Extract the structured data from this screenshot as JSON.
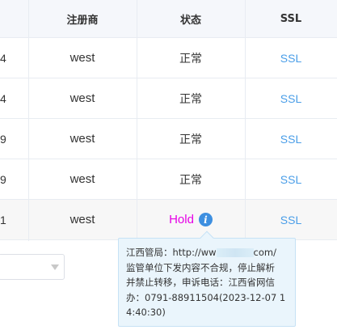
{
  "table": {
    "headers": [
      "",
      "注册商",
      "状态",
      "SSL"
    ],
    "rows": [
      {
        "num": "4",
        "registrar": "west",
        "status": "正常",
        "ssl": "SSL"
      },
      {
        "num": "4",
        "registrar": "west",
        "status": "正常",
        "ssl": "SSL"
      },
      {
        "num": "9",
        "registrar": "west",
        "status": "正常",
        "ssl": "SSL"
      },
      {
        "num": "9",
        "registrar": "west",
        "status": "正常",
        "ssl": "SSL"
      },
      {
        "num": "1",
        "registrar": "west",
        "status": "Hold",
        "ssl": "SSL"
      }
    ]
  },
  "tooltip": {
    "line1_prefix": "江西管局：http://ww",
    "line1_suffix": "com/",
    "line2": "监管单位下发内容不合规，停止解析",
    "line3": "并禁止转移，申诉电话：江西省网信",
    "line4": "办：0791-88911504(2023-12-07 1",
    "line5": "4:40:30)"
  },
  "icons": {
    "info": "info-icon",
    "dropdown": "chevron-down-icon"
  },
  "colors": {
    "ssl": "#4a9ee8",
    "hold": "#e600e6",
    "info": "#3d8fe0"
  }
}
